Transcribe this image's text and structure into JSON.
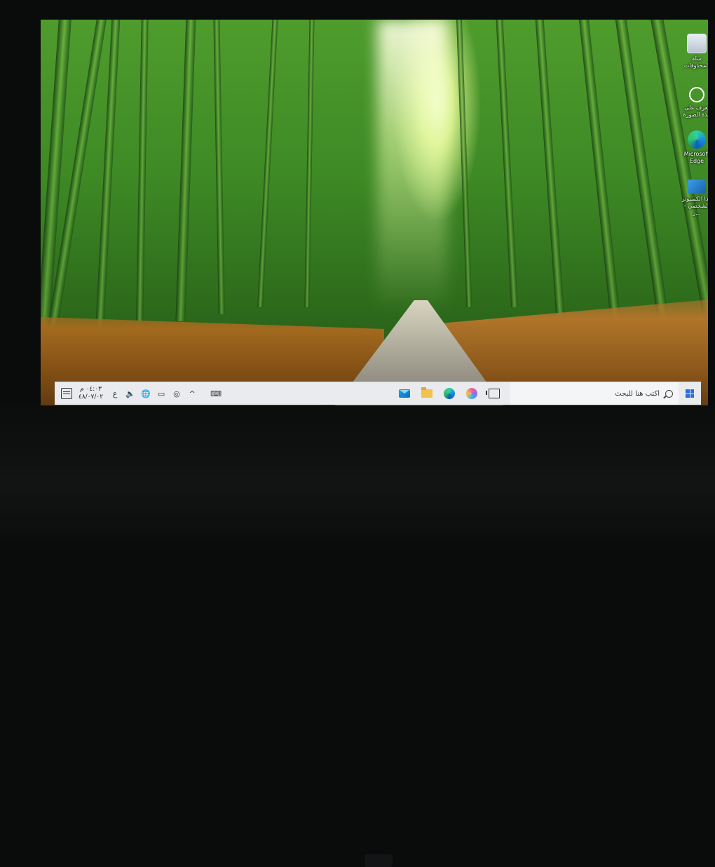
{
  "desktop_icons": [
    {
      "label": "سلة المحذوفات",
      "icon": "recycle-bin-icon"
    },
    {
      "label": "تعرف على هذة الصورة",
      "icon": "identify-image-icon"
    },
    {
      "label": "Microsoft Edge",
      "icon": "edge-icon"
    },
    {
      "label": "هذا الكمبيوتر الشخصي - ر...",
      "icon": "this-pc-icon"
    }
  ],
  "taskbar": {
    "search_placeholder": "اكتب هنا للبحث",
    "clock": {
      "time": "٠٤:٠٣ م",
      "date": "٤٨/٠٧/٠٢"
    },
    "keyboard_indicator": "ع",
    "tray_overflow": "^",
    "apps": [
      "mail-icon",
      "file-explorer-icon",
      "edge-icon",
      "copilot-icon",
      "task-view-icon"
    ]
  },
  "colors": {
    "taskbar_bg": "#e9ebee",
    "accent": "#2a6fd6"
  }
}
